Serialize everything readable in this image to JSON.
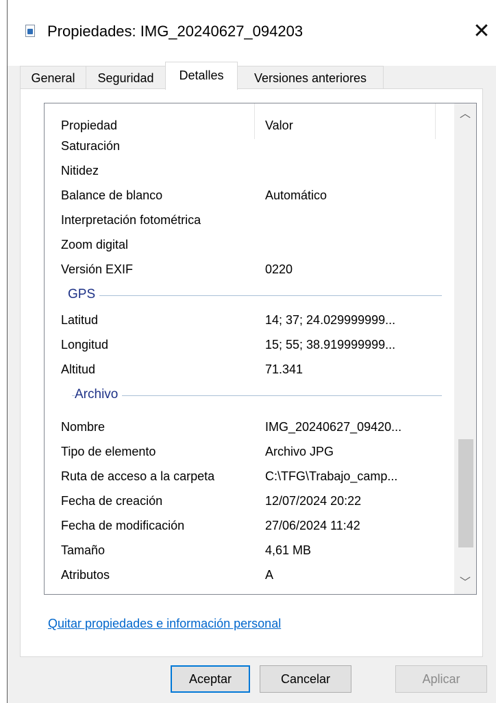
{
  "window": {
    "title": "Propiedades: IMG_20240627_094203",
    "close_glyph": "✕"
  },
  "tabs": [
    {
      "label": "General"
    },
    {
      "label": "Seguridad"
    },
    {
      "label": "Detalles",
      "active": true
    },
    {
      "label": "Versiones anteriores"
    }
  ],
  "details": {
    "columns": {
      "property": "Propiedad",
      "value": "Valor"
    },
    "rows_top": [
      {
        "property": "Saturación",
        "value": ""
      },
      {
        "property": "Nitidez",
        "value": ""
      },
      {
        "property": "Balance de blanco",
        "value": "Automático"
      },
      {
        "property": "Interpretación fotométrica",
        "value": ""
      },
      {
        "property": "Zoom digital",
        "value": ""
      },
      {
        "property": "Versión EXIF",
        "value": "0220"
      }
    ],
    "groups": [
      {
        "title": "GPS",
        "rows": [
          {
            "property": "Latitud",
            "value": "14; 37; 24.029999999..."
          },
          {
            "property": "Longitud",
            "value": "15; 55; 38.919999999..."
          },
          {
            "property": "Altitud",
            "value": "71.341"
          }
        ]
      },
      {
        "title": "Archivo",
        "rows": [
          {
            "property": "Nombre",
            "value": "IMG_20240627_09420..."
          },
          {
            "property": "Tipo de elemento",
            "value": "Archivo JPG"
          },
          {
            "property": "Ruta de acceso a la carpeta",
            "value": "C:\\TFG\\Trabajo_camp..."
          },
          {
            "property": "Fecha de creación",
            "value": "12/07/2024 20:22"
          },
          {
            "property": "Fecha de modificación",
            "value": "27/06/2024 11:42"
          },
          {
            "property": "Tamaño",
            "value": "4,61 MB"
          },
          {
            "property": "Atributos",
            "value": "A"
          }
        ]
      }
    ],
    "scroll_up_glyph": "︿",
    "scroll_down_glyph": "﹀"
  },
  "remove_link": "Quitar propiedades e información personal",
  "buttons": {
    "ok": "Aceptar",
    "cancel": "Cancelar",
    "apply": "Aplicar"
  }
}
